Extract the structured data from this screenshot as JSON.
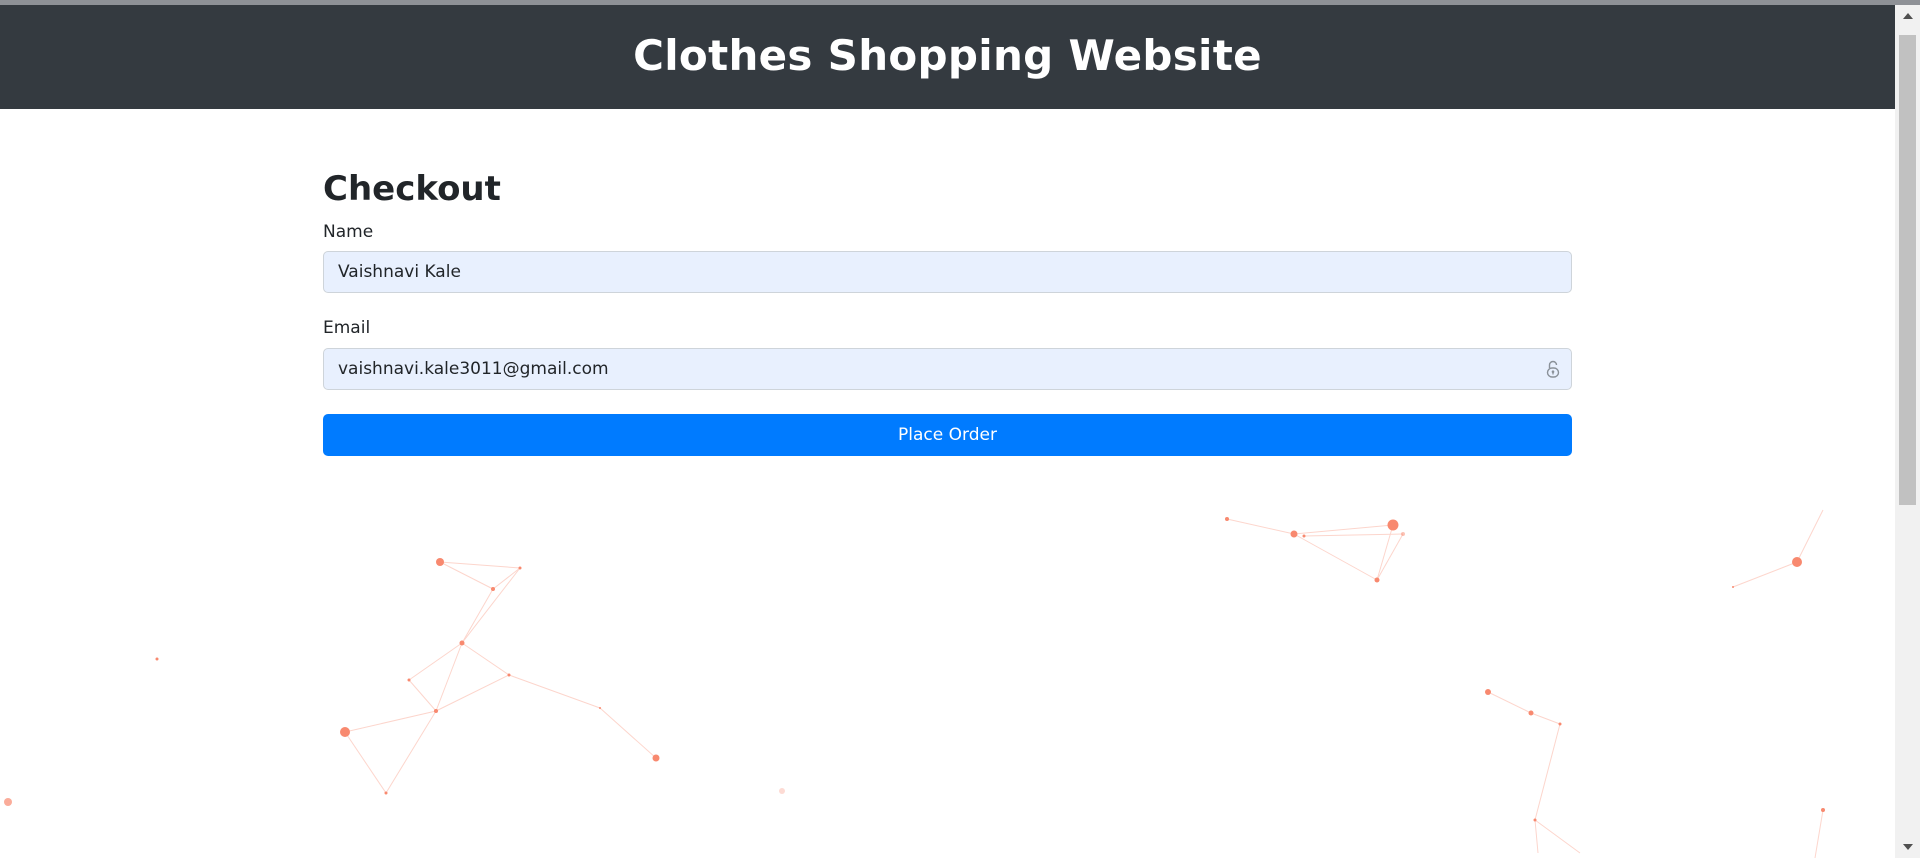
{
  "header": {
    "title": "Clothes Shopping Website"
  },
  "checkout": {
    "title": "Checkout",
    "name_label": "Name",
    "name_value": "Vaishnavi Kale",
    "email_label": "Email",
    "email_value": "vaishnavi.kale3011@gmail.com",
    "submit_label": "Place Order"
  },
  "colors": {
    "header_bg": "#343a40",
    "primary": "#007bff",
    "autofill_bg": "#e8f0fe",
    "network": "#f8896f"
  },
  "icons": {
    "email_field": "lock-icon",
    "scroll_up": "triangle-up-icon",
    "scroll_down": "triangle-down-icon"
  }
}
